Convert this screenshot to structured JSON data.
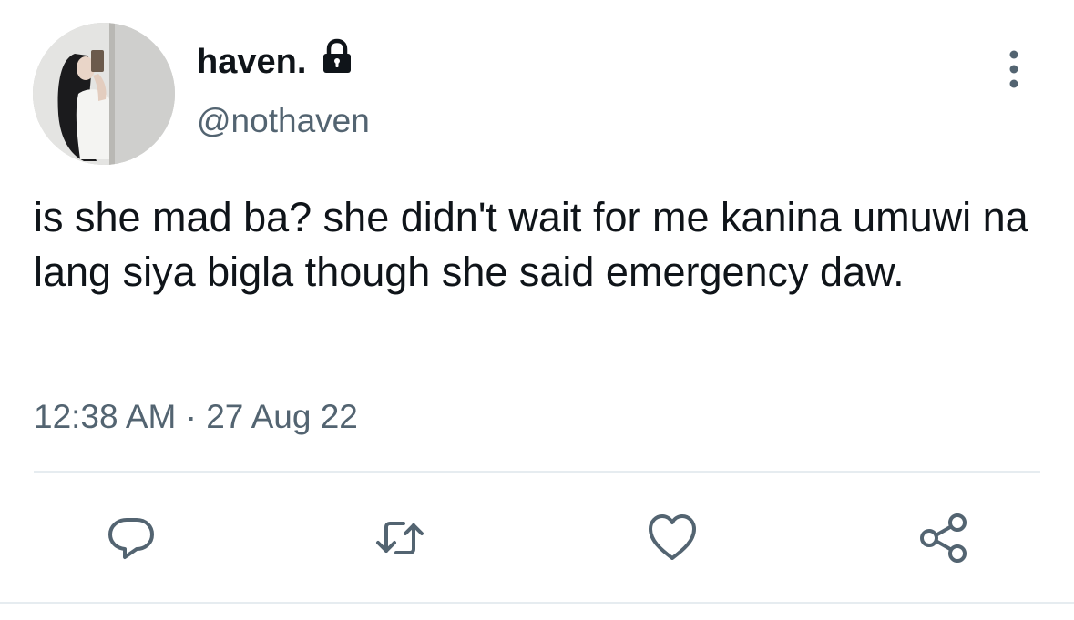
{
  "author": {
    "display_name": "haven.",
    "handle": "@nothaven",
    "protected_icon": "lock-icon",
    "avatar": "profile-photo"
  },
  "tweet": {
    "text": "is she mad ba? she didn't wait for me kanina umuwi na lang siya bigla though she said emergency daw.",
    "timestamp": "12:38 AM · 27 Aug 22"
  },
  "actions": [
    {
      "name": "reply",
      "icon": "reply-icon"
    },
    {
      "name": "retweet",
      "icon": "retweet-icon"
    },
    {
      "name": "like",
      "icon": "heart-icon"
    },
    {
      "name": "share",
      "icon": "share-icon"
    }
  ],
  "menu_icon": "more-vertical-icon",
  "colors": {
    "text_primary": "#0f1419",
    "text_secondary": "#536471",
    "icon": "#536471",
    "divider": "#e6ecf0"
  }
}
